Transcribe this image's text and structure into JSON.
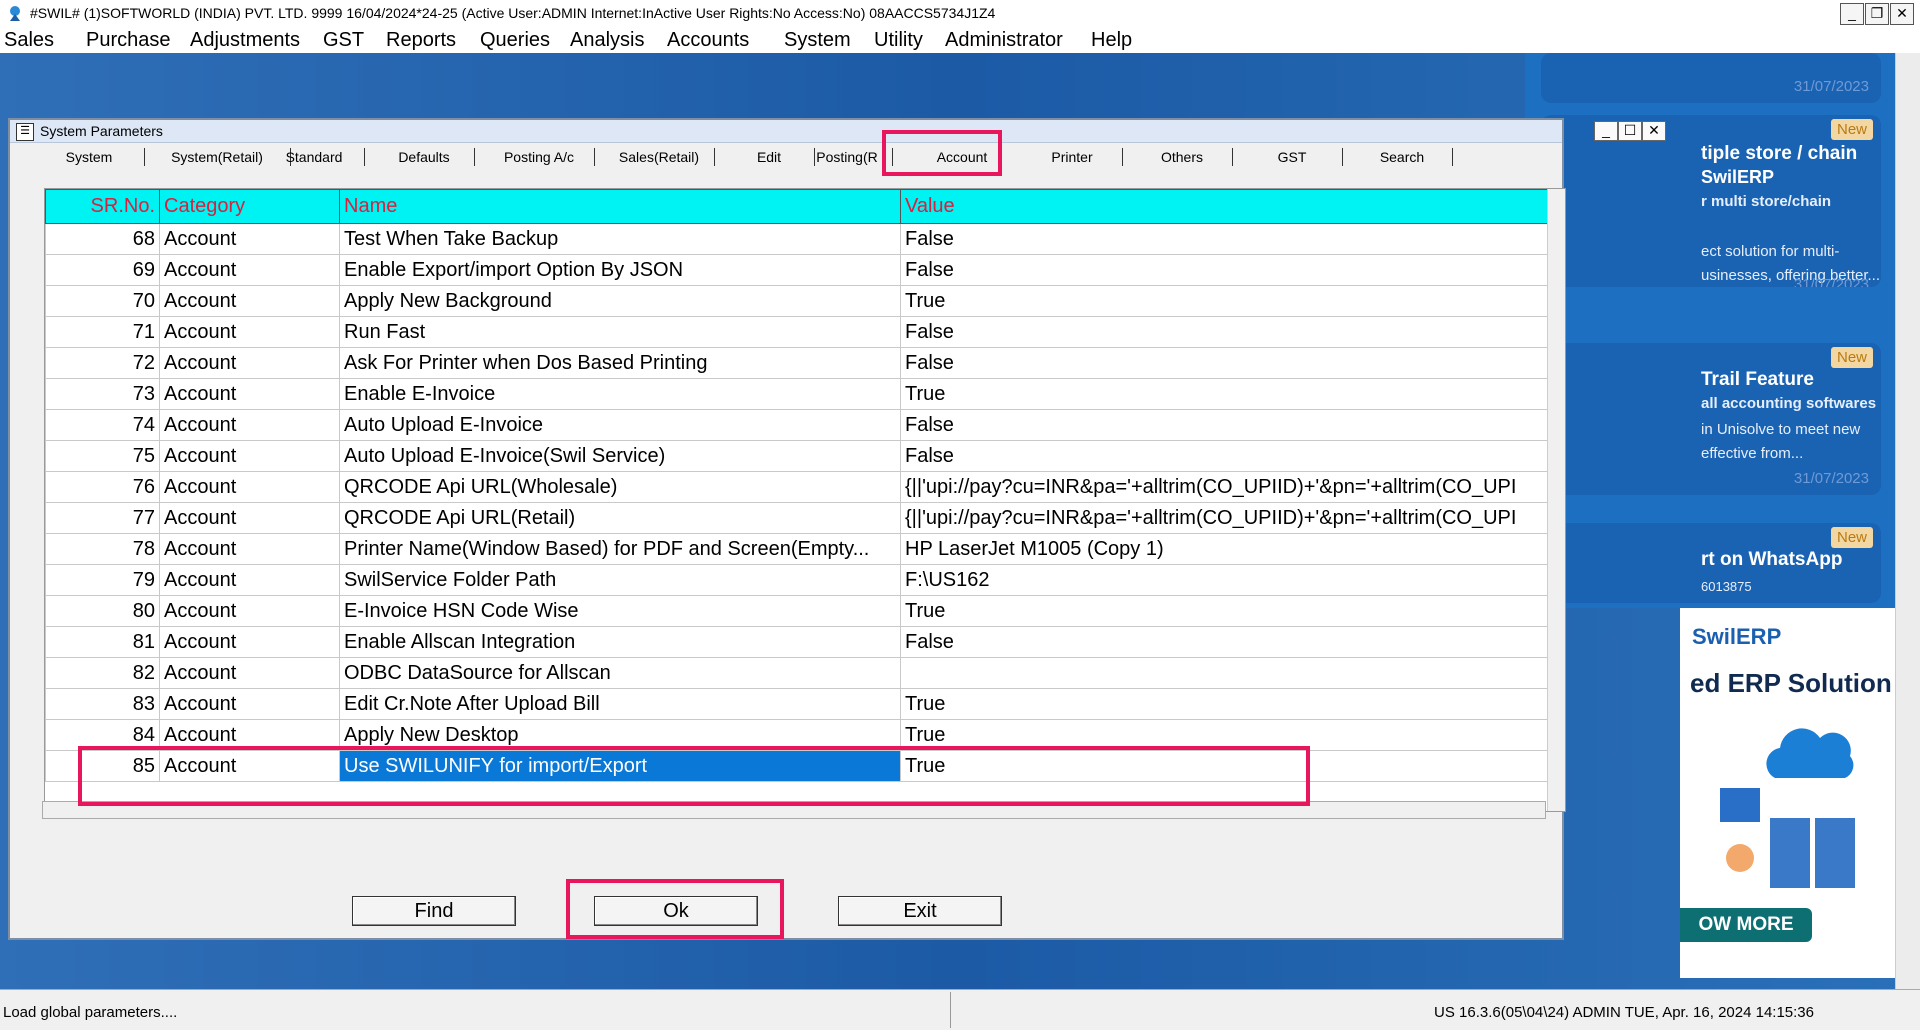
{
  "titlebar": {
    "text": "#SWIL#     (1)SOFTWORLD (INDIA) PVT. LTD. 9999    16/04/2024*24-25     (Active User:ADMIN Internet:InActive User Rights:No Access:No) 08AACCS5734J1Z4"
  },
  "menu": [
    "Sales",
    "Purchase",
    "Adjustments",
    "GST",
    "Reports",
    "Queries",
    "Analysis",
    "Accounts",
    "System",
    "Utility",
    "Administrator",
    "Help"
  ],
  "window": {
    "title": "System Parameters"
  },
  "tabs": [
    "System",
    "System(Retail)",
    "Standard",
    "Defaults",
    "Posting A/c",
    "Sales(Retail)",
    "Edit",
    "Posting(R",
    "Account",
    "Printer",
    "Others",
    "GST",
    "Search"
  ],
  "active_tab": "Account",
  "table": {
    "headers": [
      "SR.No.",
      "Category",
      "Name",
      "Value"
    ],
    "rows": [
      [
        "68",
        "Account",
        "Test When Take Backup",
        "False"
      ],
      [
        "69",
        "Account",
        "Enable Export/import Option By JSON",
        "False"
      ],
      [
        "70",
        "Account",
        "Apply New Background",
        "True"
      ],
      [
        "71",
        "Account",
        "Run Fast",
        "False"
      ],
      [
        "72",
        "Account",
        "Ask For Printer when Dos Based Printing",
        "False"
      ],
      [
        "73",
        "Account",
        "Enable E-Invoice",
        "True"
      ],
      [
        "74",
        "Account",
        "Auto Upload E-Invoice",
        "False"
      ],
      [
        "75",
        "Account",
        "Auto Upload E-Invoice(Swil Service)",
        "False"
      ],
      [
        "76",
        "Account",
        "QRCODE Api URL(Wholesale)",
        "{||'upi://pay?cu=INR&pa='+alltrim(CO_UPIID)+'&pn='+alltrim(CO_UPI"
      ],
      [
        "77",
        "Account",
        "QRCODE Api URL(Retail)",
        "{||'upi://pay?cu=INR&pa='+alltrim(CO_UPIID)+'&pn='+alltrim(CO_UPI"
      ],
      [
        "78",
        "Account",
        "Printer Name(Window Based) for PDF and Screen(Empty...",
        "HP LaserJet M1005 (Copy 1)"
      ],
      [
        "79",
        "Account",
        "SwilService Folder Path",
        "F:\\US162"
      ],
      [
        "80",
        "Account",
        "E-Invoice HSN Code Wise",
        "True"
      ],
      [
        "81",
        "Account",
        "Enable Allscan Integration",
        "False"
      ],
      [
        "82",
        "Account",
        "ODBC DataSource for Allscan",
        ""
      ],
      [
        "83",
        "Account",
        "Edit Cr.Note After Upload Bill",
        "True"
      ],
      [
        "84",
        "Account",
        "Apply New Desktop",
        "True"
      ],
      [
        "85",
        "Account",
        "Use SWILUNIFY for import/Export",
        "True"
      ]
    ],
    "selected_row": "85"
  },
  "buttons": {
    "find": "Find",
    "ok": "Ok",
    "exit": "Exit"
  },
  "news": [
    {
      "new": "New",
      "heading": "tiple store / chain",
      "line1": "SwilERP",
      "line2": "r multi store/chain",
      "line3": "ect solution for multi-",
      "line4": "usinesses, offering better...",
      "date": "31/07/2023"
    },
    {
      "new": "New",
      "heading": "Trail Feature",
      "line1": "all accounting softwares",
      "line2": "in Unisolve to meet new",
      "line3": "effective from...",
      "date": "31/07/2023"
    },
    {
      "new": "New",
      "heading": "rt on WhatsApp",
      "line1": "6013875"
    }
  ],
  "news_top_date": "31/07/2023",
  "promo": {
    "logo": "SwilERP",
    "headline": "ed ERP Solution",
    "button": "OW MORE"
  },
  "status": {
    "left": "Load global parameters....",
    "right": "US 16.3.6(05\\04\\24) ADMIN  TUE, Apr. 16, 2024  14:15:36"
  },
  "colors": {
    "highlight": "#e8175d",
    "header_bg": "#00f3f3",
    "header_text": "#d8203f",
    "selection": "#0a78d7"
  }
}
